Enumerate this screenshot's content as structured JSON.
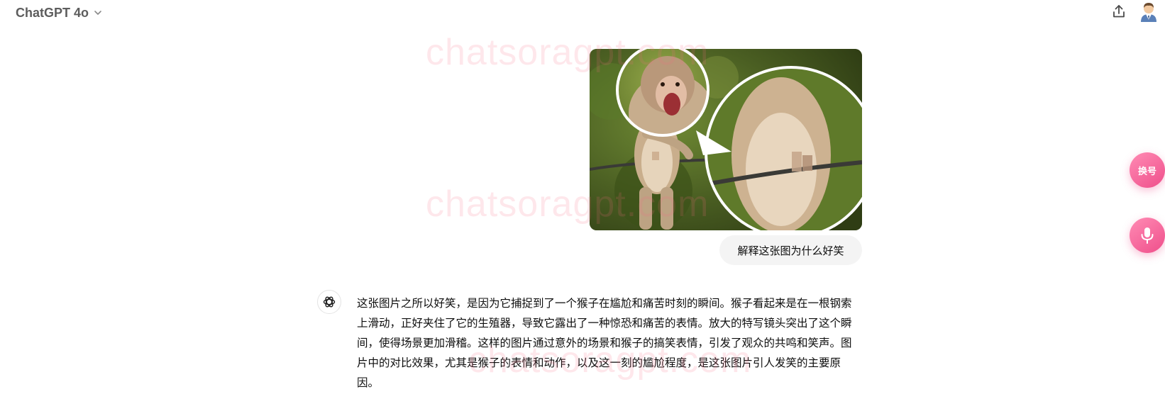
{
  "header": {
    "model_name": "ChatGPT 4o",
    "chevron_icon": "chevron-down-icon",
    "share_icon": "share-upload-icon",
    "avatar_icon": "user-avatar-icon"
  },
  "watermark": {
    "text": "chatsoragpt.com"
  },
  "conversation": {
    "user_image_alt": "monkey-photo",
    "user_message": "解释这张图为什么好笑",
    "assistant_icon": "openai-logo-icon",
    "assistant_message": "这张图片之所以好笑，是因为它捕捉到了一个猴子在尴尬和痛苦时刻的瞬间。猴子看起来是在一根钢索上滑动，正好夹住了它的生殖器，导致它露出了一种惊恐和痛苦的表情。放大的特写镜头突出了这个瞬间，使得场景更加滑稽。这样的图片通过意外的场景和猴子的搞笑表情，引发了观众的共鸣和笑声。图片中的对比效果，尤其是猴子的表情和动作，以及这一刻的尴尬程度，是这张图片引人发笑的主要原因。"
  },
  "floating": {
    "switch_label": "换号",
    "mic_icon": "microphone-icon"
  },
  "colors": {
    "accent_pink": "#ef4f8b",
    "watermark": "#fa6982",
    "bubble_bg": "#f4f4f4"
  }
}
